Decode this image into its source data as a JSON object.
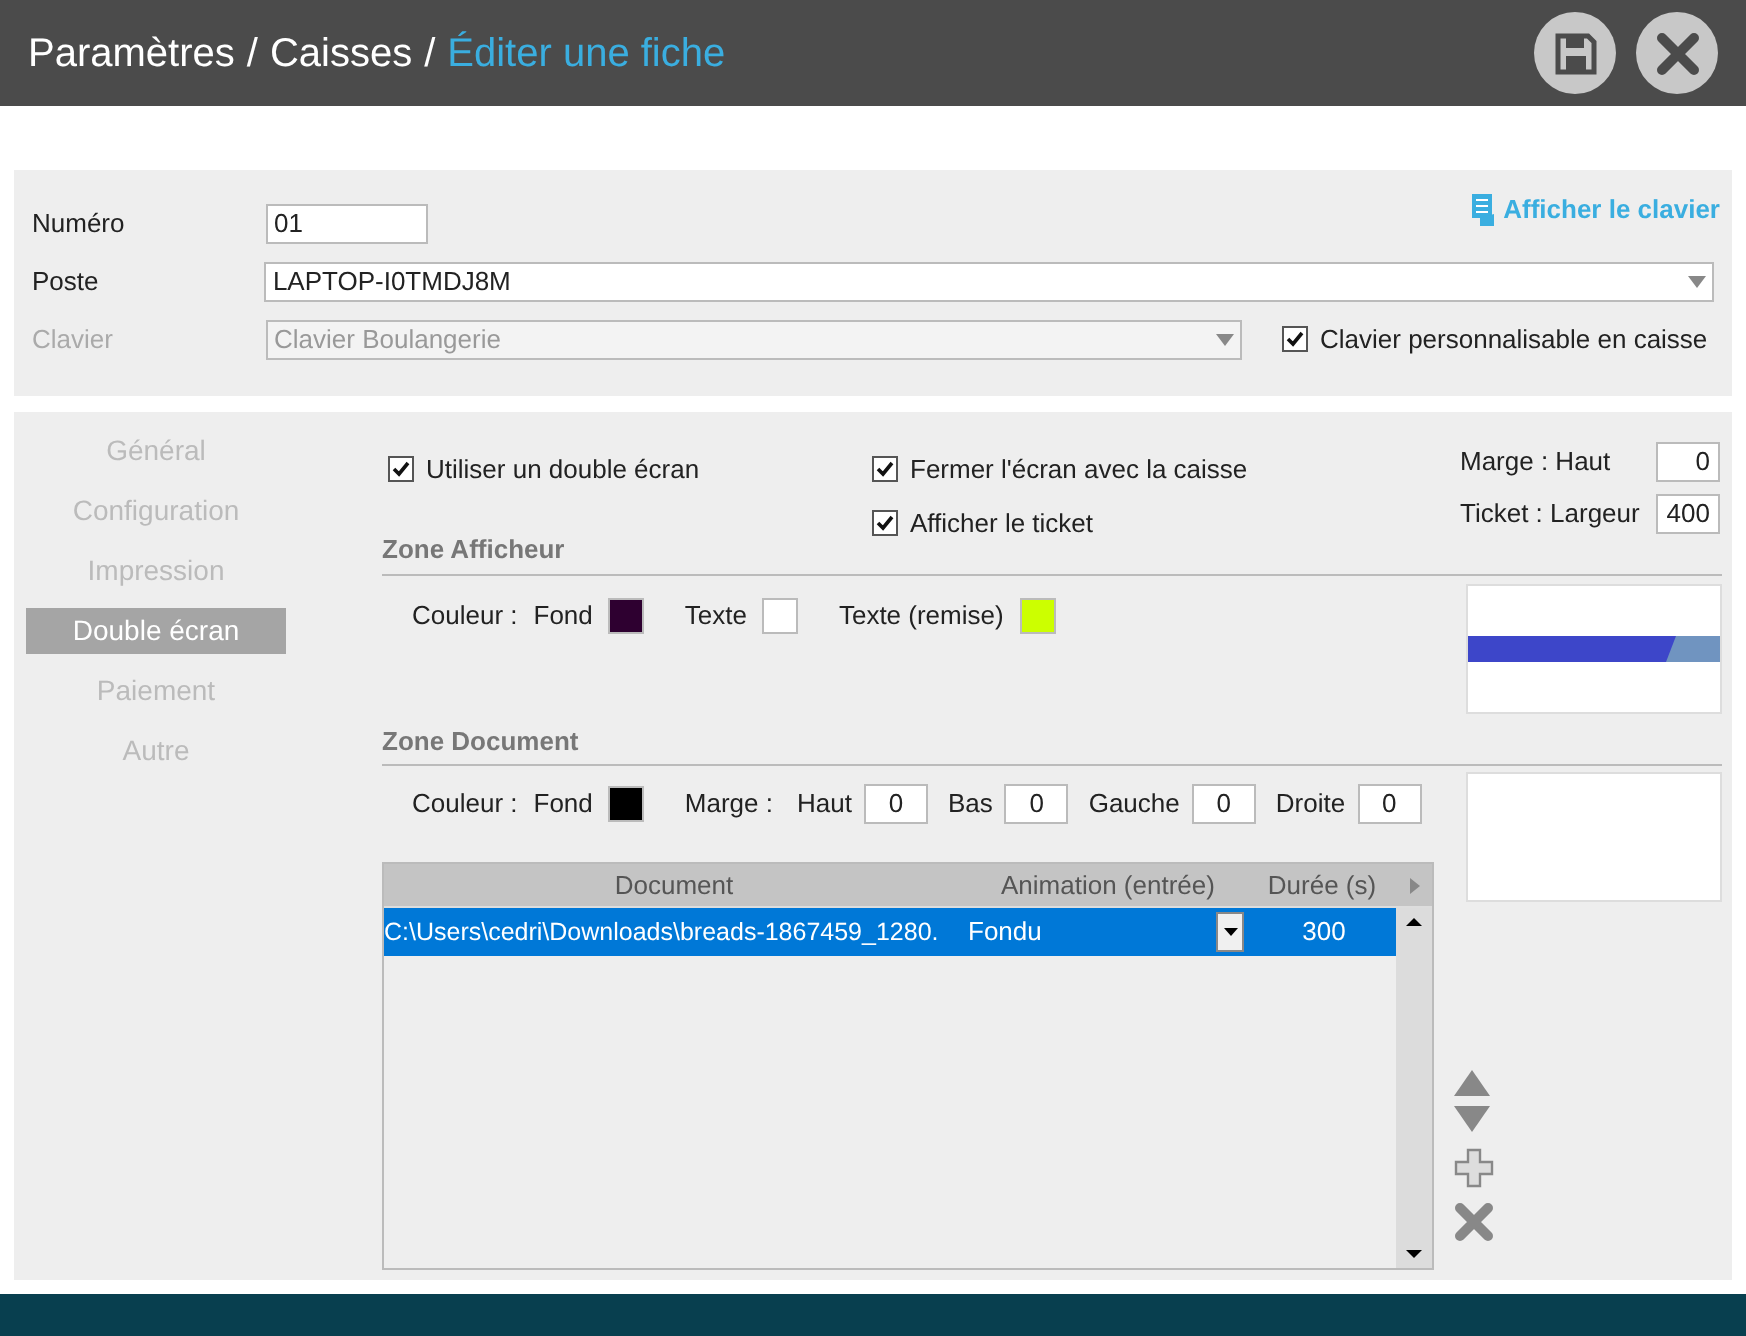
{
  "header": {
    "breadcrumb": [
      {
        "label": "Paramètres",
        "current": false
      },
      {
        "label": "Caisses",
        "current": false
      },
      {
        "label": "Éditer une fiche",
        "current": true
      }
    ],
    "separator": "/"
  },
  "top": {
    "keyboard_link": "Afficher le clavier",
    "fields": [
      {
        "label": "Numéro",
        "value": "01",
        "kind": "text",
        "disabled": false
      },
      {
        "label": "Poste",
        "value": "LAPTOP-I0TMDJ8M",
        "kind": "select",
        "disabled": false
      },
      {
        "label": "Clavier",
        "value": "Clavier Boulangerie",
        "kind": "select",
        "disabled": true
      }
    ],
    "custom_keyboard": {
      "label": "Clavier personnalisable en caisse",
      "checked": true
    }
  },
  "sidebar": {
    "items": [
      {
        "label": "Général",
        "selected": false
      },
      {
        "label": "Configuration",
        "selected": false
      },
      {
        "label": "Impression",
        "selected": false
      },
      {
        "label": "Double écran",
        "selected": true
      },
      {
        "label": "Paiement",
        "selected": false
      },
      {
        "label": "Autre",
        "selected": false
      }
    ]
  },
  "options": [
    {
      "label": "Utiliser un double écran",
      "checked": true
    },
    {
      "label": "Fermer l'écran avec la caisse",
      "checked": true
    },
    {
      "label": "Afficher le ticket",
      "checked": true
    }
  ],
  "ticket": [
    {
      "label": "Marge : Haut",
      "value": "0"
    },
    {
      "label": "Ticket : Largeur",
      "value": "400"
    }
  ],
  "zone_afficheur": {
    "title": "Zone Afficheur",
    "color_label": "Couleur :",
    "swatches": [
      {
        "label": "Fond",
        "color": "#2e0030"
      },
      {
        "label": "Texte",
        "color": "#ffffff"
      },
      {
        "label": "Texte (remise)",
        "color": "#ccff00"
      }
    ]
  },
  "zone_document": {
    "title": "Zone Document",
    "color_label": "Couleur :",
    "swatches": [
      {
        "label": "Fond",
        "color": "#000000"
      }
    ],
    "margin_label": "Marge :",
    "margins": [
      {
        "label": "Haut",
        "value": "0"
      },
      {
        "label": "Bas",
        "value": "0"
      },
      {
        "label": "Gauche",
        "value": "0"
      },
      {
        "label": "Droite",
        "value": "0"
      }
    ]
  },
  "table": {
    "columns": [
      "Document",
      "Animation (entrée)",
      "Durée (s)"
    ],
    "rows": [
      {
        "document": "C:\\Users\\cedri\\Downloads\\breads-1867459_1280.",
        "animation": "Fondu",
        "duration": "300",
        "selected": true
      }
    ]
  }
}
